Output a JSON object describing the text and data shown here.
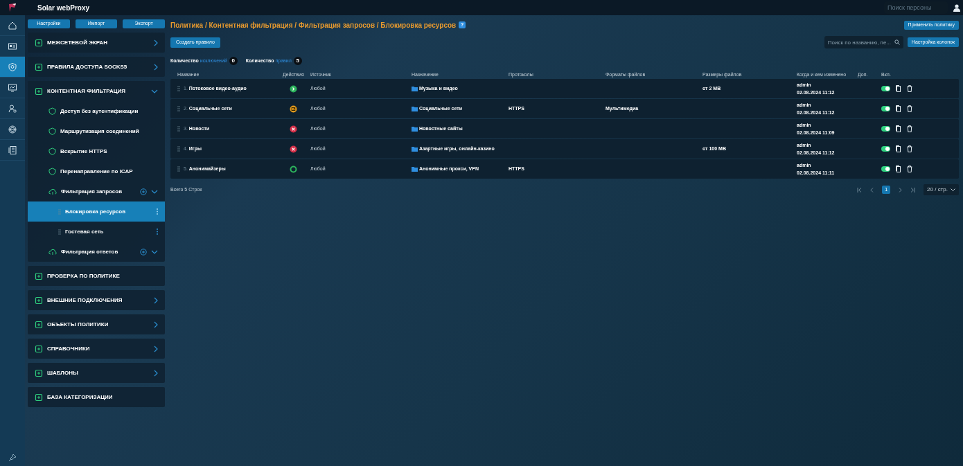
{
  "app_title": "Solar webProxy",
  "person_search": {
    "placeholder": "Поиск персоны"
  },
  "rail": [
    {
      "kind": "home",
      "selected": false
    },
    {
      "kind": "card",
      "selected": false
    },
    {
      "kind": "shield",
      "selected": true
    },
    {
      "kind": "monitor",
      "selected": false
    },
    {
      "kind": "user",
      "selected": false
    },
    {
      "kind": "globe",
      "selected": false
    },
    {
      "kind": "list",
      "selected": false
    }
  ],
  "nav_buttons": [
    "Настройки",
    "Импорт",
    "Экспорт"
  ],
  "nav": [
    {
      "label": "МЕЖСЕТЕВОЙ ЭКРАН",
      "expandable": true,
      "expanded": false
    },
    {
      "label": "ПРАВИЛА ДОСТУПА SOCKS5",
      "expandable": true,
      "expanded": false
    },
    {
      "label": "КОНТЕНТНАЯ ФИЛЬТРАЦИЯ",
      "expandable": true,
      "expanded": true,
      "children": [
        {
          "label": "Доступ без аутентификации",
          "addable": false
        },
        {
          "label": "Маршрутизация соединений",
          "addable": false
        },
        {
          "label": "Вскрытие HTTPS",
          "addable": false
        },
        {
          "label": "Перенаправление по ICAP",
          "addable": false
        },
        {
          "label": "Фильтрация запросов",
          "addable": true,
          "children": [
            {
              "label": "Блокировка ресурсов",
              "selected": true
            },
            {
              "label": "Гостевая сеть",
              "selected": false
            }
          ]
        },
        {
          "label": "Фильтрация ответов",
          "addable": true
        }
      ]
    },
    {
      "label": "ПРОВЕРКА ПО ПОЛИТИКЕ",
      "expandable": false,
      "expanded": false
    },
    {
      "label": "ВНЕШНИЕ ПОДКЛЮЧЕНИЯ",
      "expandable": true,
      "expanded": false
    },
    {
      "label": "ОБЪЕКТЫ ПОЛИТИКИ",
      "expandable": true,
      "expanded": false
    },
    {
      "label": "СПРАВОЧНИКИ",
      "expandable": true,
      "expanded": false
    },
    {
      "label": "ШАБЛОНЫ",
      "expandable": true,
      "expanded": false
    },
    {
      "label": "БАЗА КАТЕГОРИЗАЦИИ",
      "expandable": false,
      "expanded": false
    }
  ],
  "breadcrumb": "Политика / Контентная фильтрация / Фильтрация запросов / Блокировка ресурсов",
  "help": "?",
  "apply_button": "Применить политику",
  "create_button": "Создать правило",
  "search": {
    "placeholder": "Поиск по названию, пе..."
  },
  "columns_button": "Настройка колонок",
  "counters": [
    {
      "prefix": "Количество",
      "link": "исключений",
      "count": "0"
    },
    {
      "prefix": "Количество",
      "link": "правил",
      "count": "5"
    }
  ],
  "table": {
    "columns": [
      "Название",
      "Действия",
      "Источник",
      "Назначение",
      "Протоколы",
      "Форматы файлов",
      "Размеры файлов",
      "Когда и кем изменено",
      "Доп.",
      "Вкл."
    ],
    "rows": [
      {
        "index": "1.",
        "name": "Потоковое видео-аудио",
        "kind": "allow",
        "source": "Любой",
        "destination": "Музыка и видео",
        "protocols": "",
        "formats": "",
        "sizes": "от 2 MB",
        "user": "admin",
        "changed": "02.08.2024 11:12",
        "on": true
      },
      {
        "index": "2.",
        "name": "Социальные сети",
        "kind": "modify",
        "source": "Любой",
        "destination": "Социальные сети",
        "protocols": "HTTPS",
        "formats": "Мультимедиа",
        "sizes": "",
        "user": "admin",
        "changed": "02.08.2024 11:12",
        "on": true
      },
      {
        "index": "3.",
        "name": "Новости",
        "kind": "block",
        "source": "Любой",
        "destination": "Новостные сайты",
        "protocols": "",
        "formats": "",
        "sizes": "",
        "user": "admin",
        "changed": "02.08.2024 11:09",
        "on": true
      },
      {
        "index": "4.",
        "name": "Игры",
        "kind": "block",
        "source": "Любой",
        "destination": "Азартные игры, онлайн-казино",
        "protocols": "",
        "formats": "",
        "sizes": "от 100 MB",
        "user": "admin",
        "changed": "02.08.2024 11:12",
        "on": true
      },
      {
        "index": "5.",
        "name": "Анонимайзеры",
        "kind": "monitor",
        "source": "Любой",
        "destination": "Анонимные прокси, VPN",
        "protocols": "HTTPS",
        "formats": "",
        "sizes": "",
        "user": "admin",
        "changed": "02.08.2024 11:11",
        "on": true
      }
    ]
  },
  "total": "Всего 5 Строк",
  "pagination": {
    "pages": [
      {
        "label": "1",
        "selected": true
      }
    ],
    "page_size": "20 / стр."
  }
}
